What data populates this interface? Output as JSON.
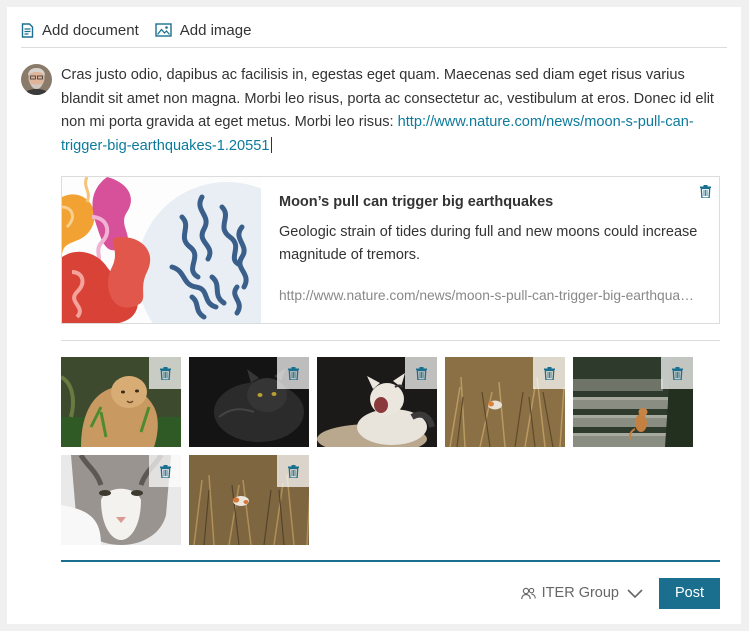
{
  "toolbar": {
    "add_document": "Add document",
    "add_image": "Add image"
  },
  "post": {
    "text": "Cras justo odio, dapibus ac facilisis in, egestas eget quam. Maecenas sed diam eget risus varius blandit sit amet non magna. Morbi leo risus, porta ac consectetur ac, vestibulum at eros. Donec id elit non mi porta gravida at eget metus. Morbi leo risus: ",
    "link": "http://www.nature.com/news/moon-s-pull-can-trigger-big-earthquakes-1.20551"
  },
  "link_preview": {
    "title": "Moon’s pull can trigger big earthquakes",
    "description": "Geologic strain of tides during full and new moons could increase magnitude of tremors.",
    "url": "http://www.nature.com/news/moon-s-pull-can-trigger-big-earthquakes-1.20551"
  },
  "images": [
    {
      "subject": "lioness"
    },
    {
      "subject": "black-cat"
    },
    {
      "subject": "yawning-cat"
    },
    {
      "subject": "cat-in-grass"
    },
    {
      "subject": "cat-on-steps"
    },
    {
      "subject": "cat-face"
    },
    {
      "subject": "cat-in-grass-2"
    }
  ],
  "footer": {
    "group": "ITER Group",
    "post_label": "Post"
  },
  "colors": {
    "accent": "#1a6f8e",
    "link": "#0c7a9c"
  }
}
